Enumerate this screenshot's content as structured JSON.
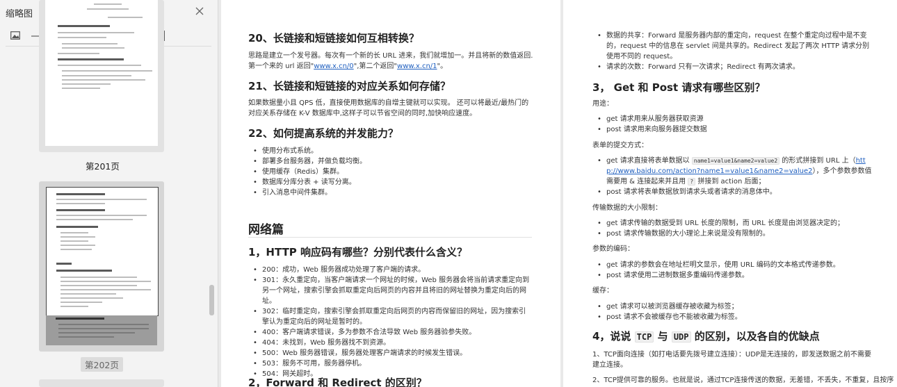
{
  "sidebar": {
    "title": "缩略图",
    "close_icon": "close-icon",
    "zoom_out_icon": "image-small-icon",
    "zoom_in_icon": "image-large-icon",
    "thumbnails": [
      {
        "label": "第201页",
        "selected": false
      },
      {
        "label": "第202页",
        "selected": true
      }
    ]
  },
  "left_page": {
    "s20": {
      "title": "20、长链接和短链接如何互相转换？",
      "p1": "思路是建立一个发号器。每次有一个新的长 URL 进来，我们就增加一。并且将新的数值返回.第一个来的 url 返回\"",
      "link1": "www.x.cn/0",
      "p2": "\",第二个返回\"",
      "link2": "www.x.cn/1",
      "p3": "\"。"
    },
    "s21": {
      "title": "21、长链接和短链接的对应关系如何存储？",
      "text": "如果数据量小且 QPS 低，直接使用数据库的自增主键就可以实现。 还可以将最近/最热门的对应关系存储在 K-V 数据库中,这样子可以节省空间的同时,加快响应速度。"
    },
    "s22": {
      "title": "22、如何提高系统的并发能力？",
      "items": [
        "使用分布式系统。",
        "部署多台服务器，并做负载均衡。",
        "使用缓存（Redis）集群。",
        "数据库分库分表 + 读写分离。",
        "引入消息中间件集群。"
      ]
    },
    "net": {
      "title": "网络篇",
      "q1_title": "1，HTTP 响应码有哪些？分别代表什么含义？",
      "q1_items": [
        "200：成功，Web 服务器成功处理了客户端的请求。",
        "301：永久重定向，当客户端请求一个网址的时候，Web 服务器会将当前请求重定向到另一个网址，搜索引擎会抓取重定向后网页的内容并且将旧的网址替换为重定向后的网址。",
        "302：临时重定向，搜索引擎会抓取重定向后网页的内容而保留旧的网址，因为搜索引擎认为重定向后的网址是暂时的。",
        "400：客户端请求错误，多为参数不合法导致 Web 服务器验参失败。",
        "404：未找到，Web 服务器找不到资源。",
        "500：Web 服务器错误，服务器处理客户端请求的时候发生错误。",
        "503：服务不可用，服务器停机。",
        "504：网关超时。"
      ],
      "q2_title": "2，Forward 和 Redirect 的区别？"
    }
  },
  "right_page": {
    "top_items": [
      "数据的共享：Forward 是服务器内部的重定向，request 在整个重定向过程中是不变的，request 中的信息在 servlet 间是共享的。Redirect 发起了两次 HTTP 请求分别使用不同的 request。",
      "请求的次数：Forward 只有一次请求；Redirect 有两次请求。"
    ],
    "q3_title": "3，  Get 和 Post 请求有哪些区别？",
    "usage_label": "用途：",
    "usage_items": [
      "get 请求用来从服务器获取资源",
      "post 请求用来向服务器提交数据"
    ],
    "form_label": "表单的提交方式：",
    "form_get_pre": "get 请求直接将表单数据以 ",
    "form_get_code": "name1=value1&name2=value2",
    "form_get_mid": " 的形式拼接到 URL 上（",
    "form_get_link": "http://www.baidu.com/action?name1=value1&name2=value2",
    "form_get_post": "），多个参数参数值需要用 & 连接起来并且用 ",
    "form_get_code2": "?",
    "form_get_end": " 拼接到 action 后面；",
    "form_post": "post 请求将表单数据放到请求头或者请求的消息体中。",
    "size_label": "传输数据的大小限制：",
    "size_items": [
      "get 请求传输的数据受到 URL 长度的限制，而 URL 长度是由浏览器决定的；",
      "post 请求传输数据的大小理论上来说是没有限制的。"
    ],
    "enc_label": "参数的编码：",
    "enc_items": [
      "get 请求的参数会在地址栏明文显示，使用 URL 编码的文本格式传递参数。",
      "post 请求使用二进制数据多重编码传递参数。"
    ],
    "cache_label": "缓存：",
    "cache_items": [
      "get 请求可以被浏览器缓存被收藏为标签；",
      "post 请求不会被缓存也不能被收藏为标签。"
    ],
    "q4_pre": "4，说说 ",
    "q4_tcp": "TCP",
    "q4_and": " 与 ",
    "q4_udp": "UDP",
    "q4_post": " 的区别，以及各自的优缺点",
    "p1": "1、TCP面向连接（如打电话要先拨号建立连接）：UDP是无连接的，即发送数据之前不需要建立连接。",
    "p2": "2、TCP提供可靠的服务。也就是说，通过TCP连接传送的数据，无差错，不丢失，不重复，且按序"
  }
}
